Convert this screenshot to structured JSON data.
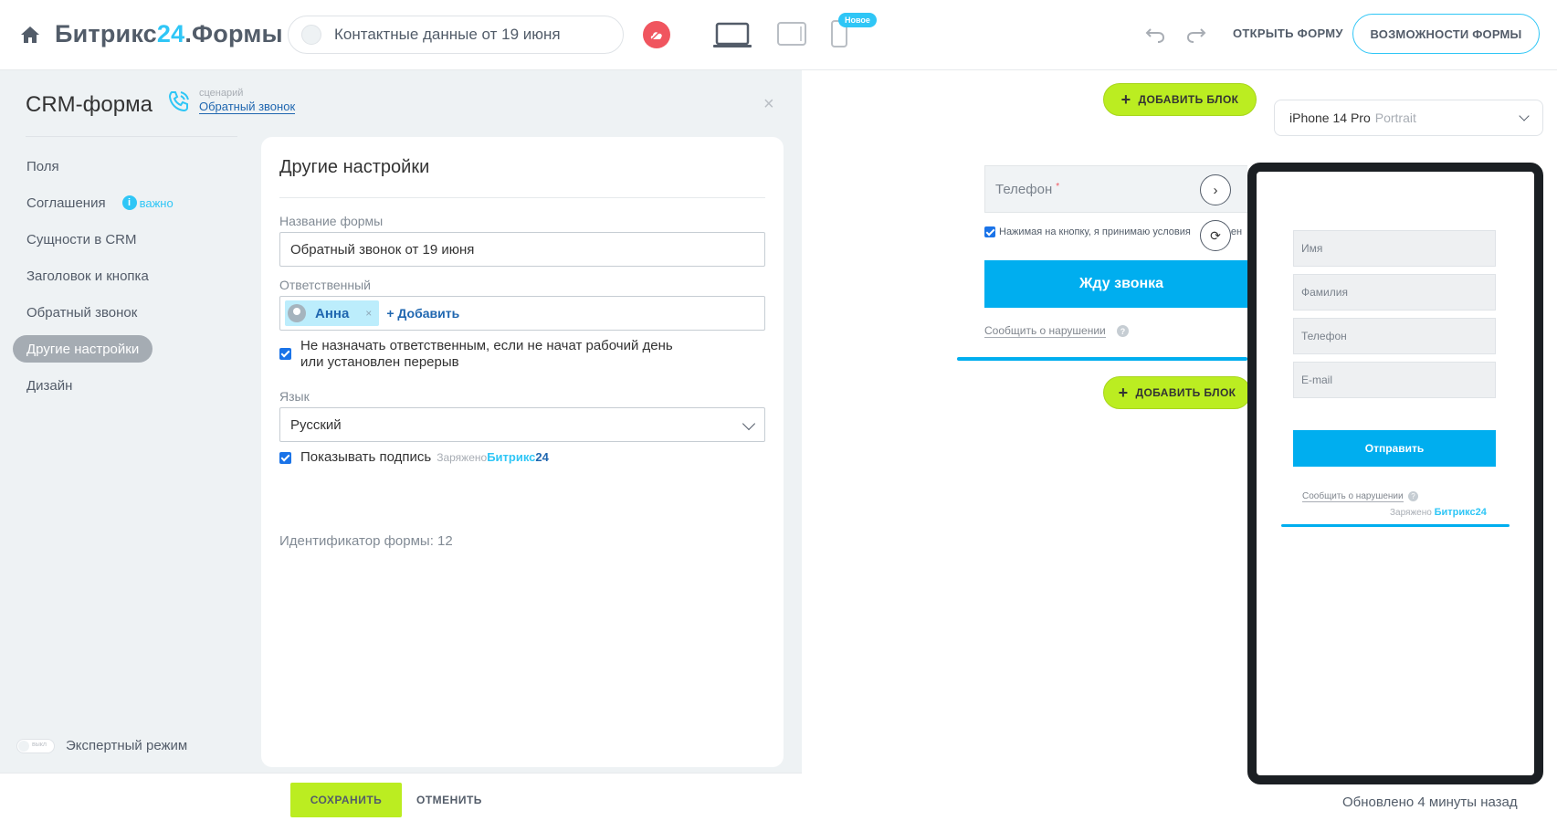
{
  "topbar": {
    "app_name_prefix": "Битрикс",
    "app_name_accent": "24",
    "app_name_suffix": ".Формы",
    "form_selector": "Контактные данные от 19 июня",
    "new_badge": "Новое",
    "open_form": "ОТКРЫТЬ ФОРМУ",
    "features": "ВОЗМОЖНОСТИ ФОРМЫ"
  },
  "left": {
    "title": "CRM-форма",
    "scenario_label": "сценарий",
    "scenario_link": "Обратный звонок",
    "close": "×",
    "nav": [
      {
        "label": "Поля"
      },
      {
        "label": "Соглашения",
        "badge": "важно"
      },
      {
        "label": "Сущности в CRM"
      },
      {
        "label": "Заголовок и кнопка"
      },
      {
        "label": "Обратный звонок"
      },
      {
        "label": "Другие настройки",
        "active": true
      },
      {
        "label": "Дизайн"
      }
    ],
    "expert_toggle_state": "выкл",
    "expert_mode": "Экспертный режим"
  },
  "settings": {
    "title": "Другие настройки",
    "form_name_label": "Название формы",
    "form_name_value": "Обратный звонок от 19 июня",
    "responsible_label": "Ответственный",
    "responsible_name": "Анна",
    "responsible_remove": "×",
    "add_responsible": "+ Добавить",
    "no_assign_text": "Не назначать ответственным, если не начат рабочий день или установлен перерыв",
    "language_label": "Язык",
    "language_value": "Русский",
    "show_signature": "Показывать подпись",
    "powered_by": "Заряжено",
    "brand_prefix": "Битрикс",
    "brand_suffix": "24",
    "form_id": "Идентификатор формы: 12"
  },
  "footer": {
    "save": "СОХРАНИТЬ",
    "cancel": "ОТМЕНИТЬ"
  },
  "preview": {
    "add_block": "ДОБАВИТЬ БЛОК",
    "device_name": "iPhone 14 Pro",
    "device_orientation": "Portrait",
    "desktop": {
      "phone_label": "Телефон",
      "required_mark": "*",
      "agree_text": "Нажимая на кнопку, я принимаю условия",
      "agree_tail": "ен",
      "submit": "Жду звонка",
      "report": "Сообщить о нарушении",
      "help": "?"
    },
    "mobile": {
      "fields": [
        "Имя",
        "Фамилия",
        "Телефон",
        "E-mail"
      ],
      "submit": "Отправить",
      "report": "Сообщить о нарушении",
      "help": "?",
      "powered_by": "Заряжено",
      "brand": "Битрикс24"
    },
    "updated": "Обновлено 4 минуты назад"
  }
}
